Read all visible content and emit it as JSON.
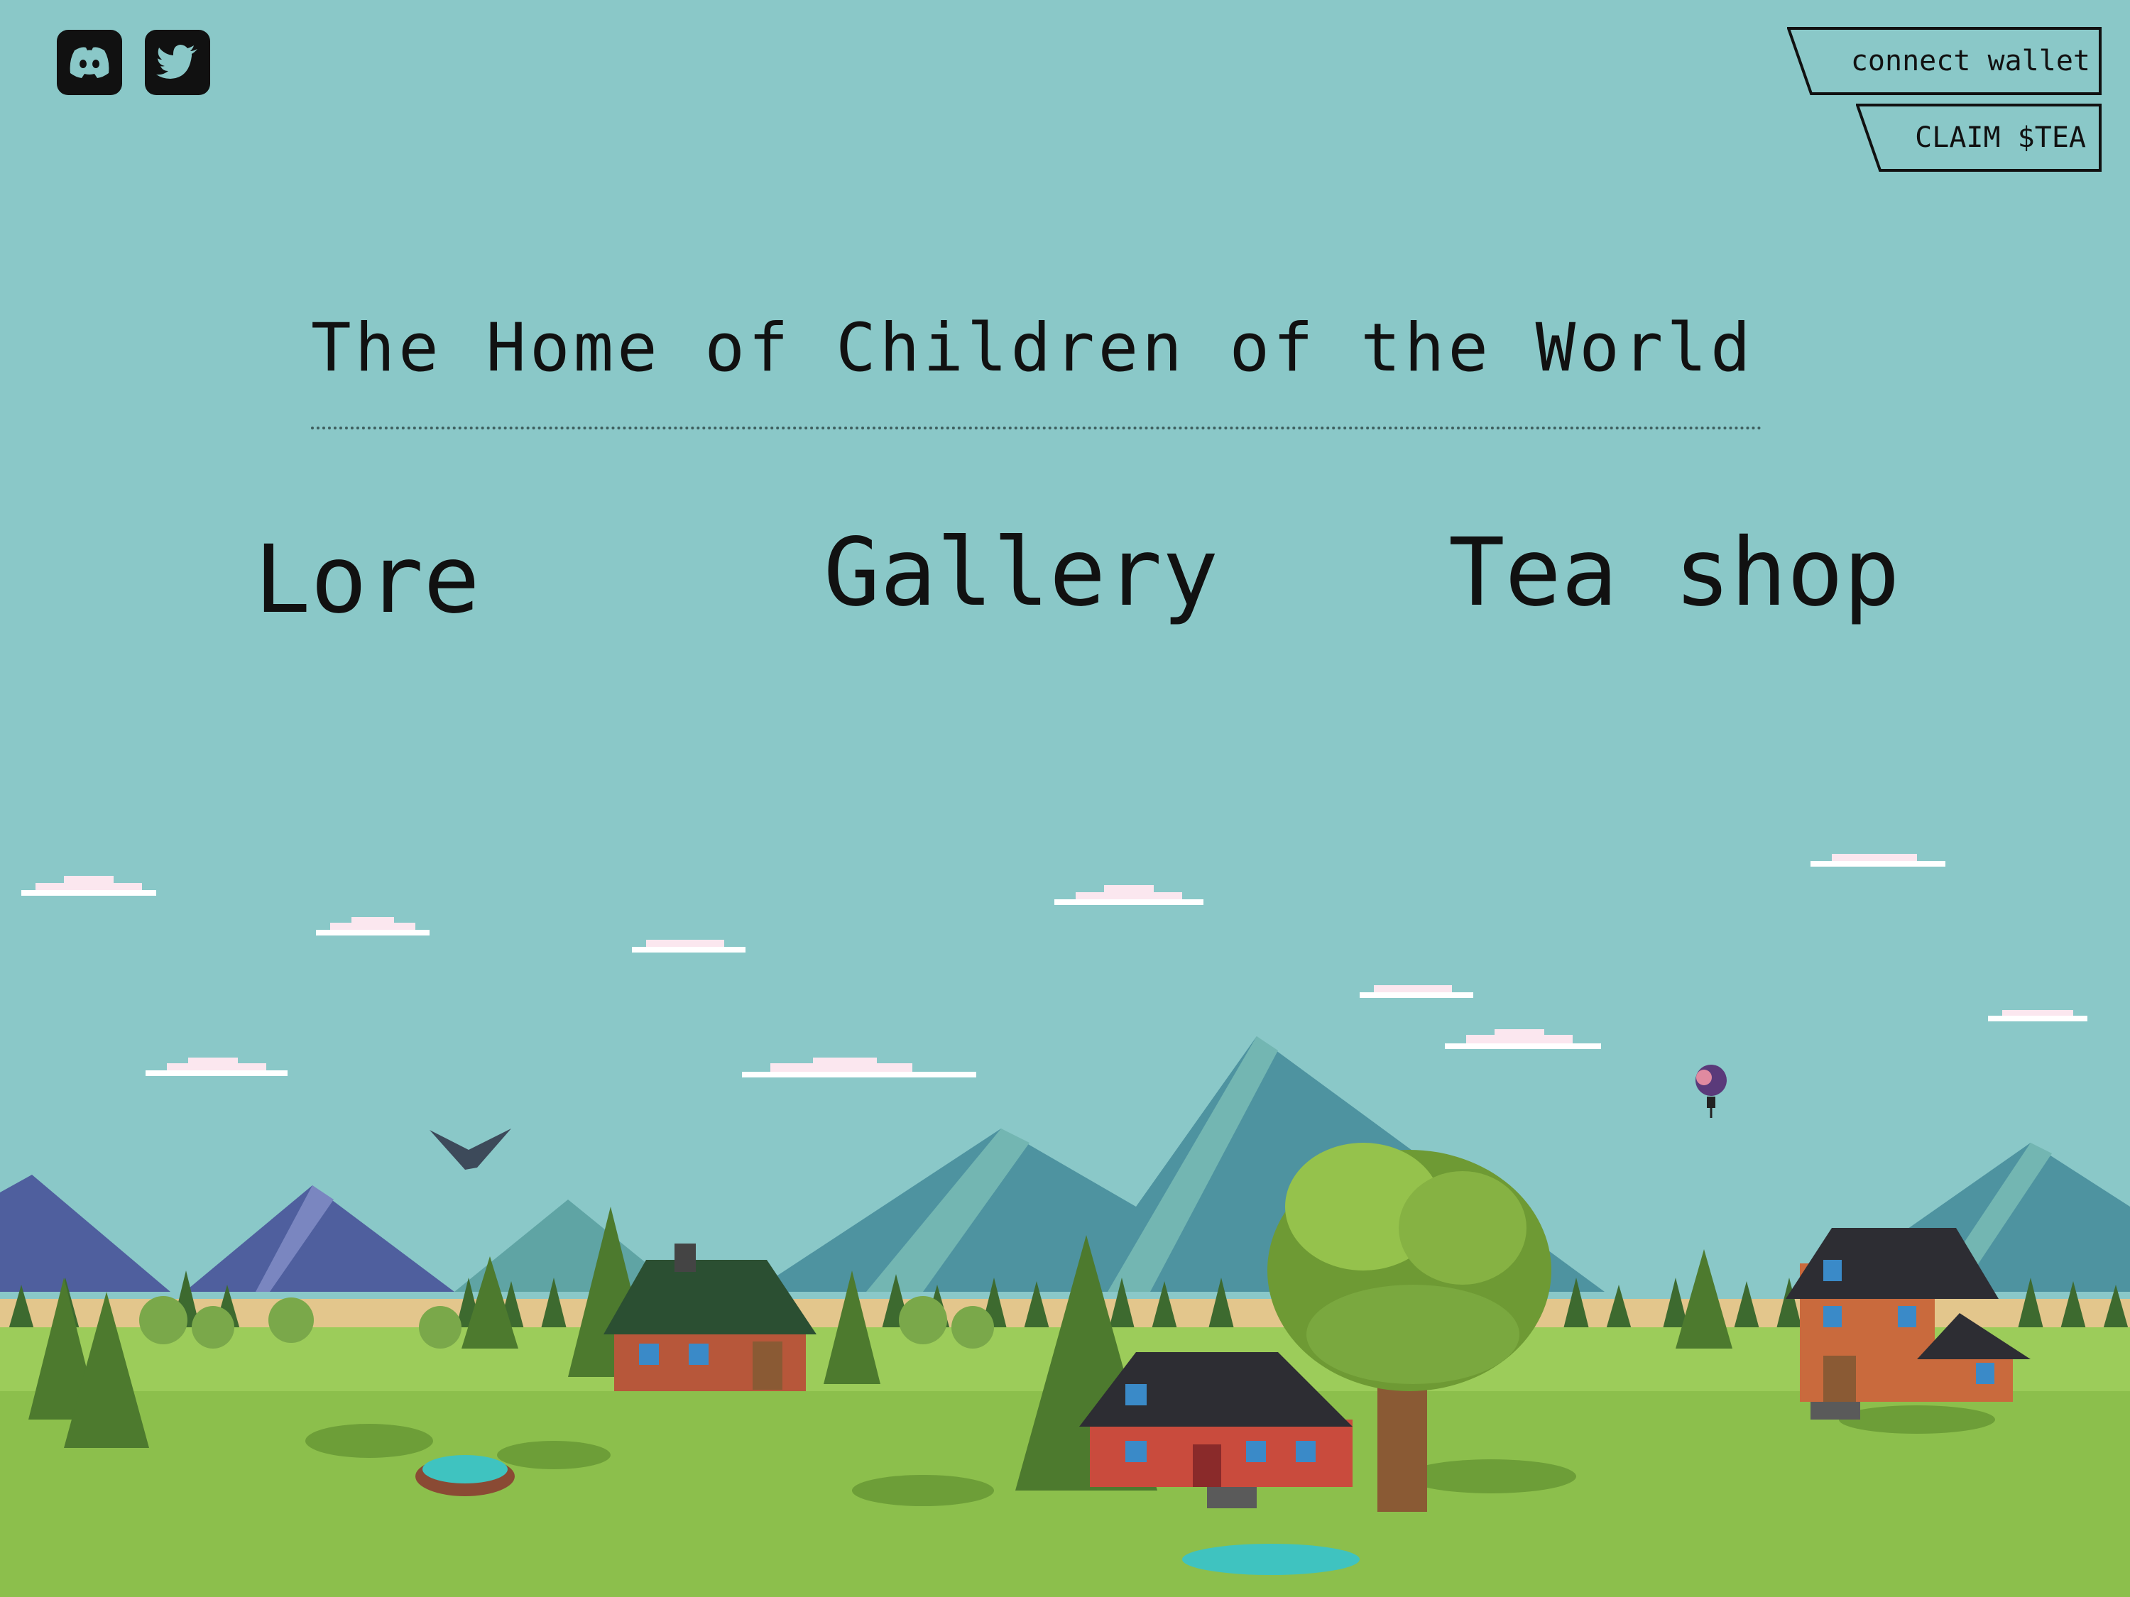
{
  "header": {
    "social_icons": [
      "discord-icon",
      "twitter-icon"
    ],
    "connect_wallet_label": "connect wallet",
    "claim_label": "CLAIM $TEA"
  },
  "hero": {
    "title": "The Home of Children of the World"
  },
  "nav": {
    "items": [
      {
        "label": "Lore"
      },
      {
        "label": "Gallery"
      },
      {
        "label": "Tea shop"
      }
    ]
  },
  "colors": {
    "sky": "#8ac8c8",
    "grass": "#9ccc5a",
    "text": "#111111"
  }
}
